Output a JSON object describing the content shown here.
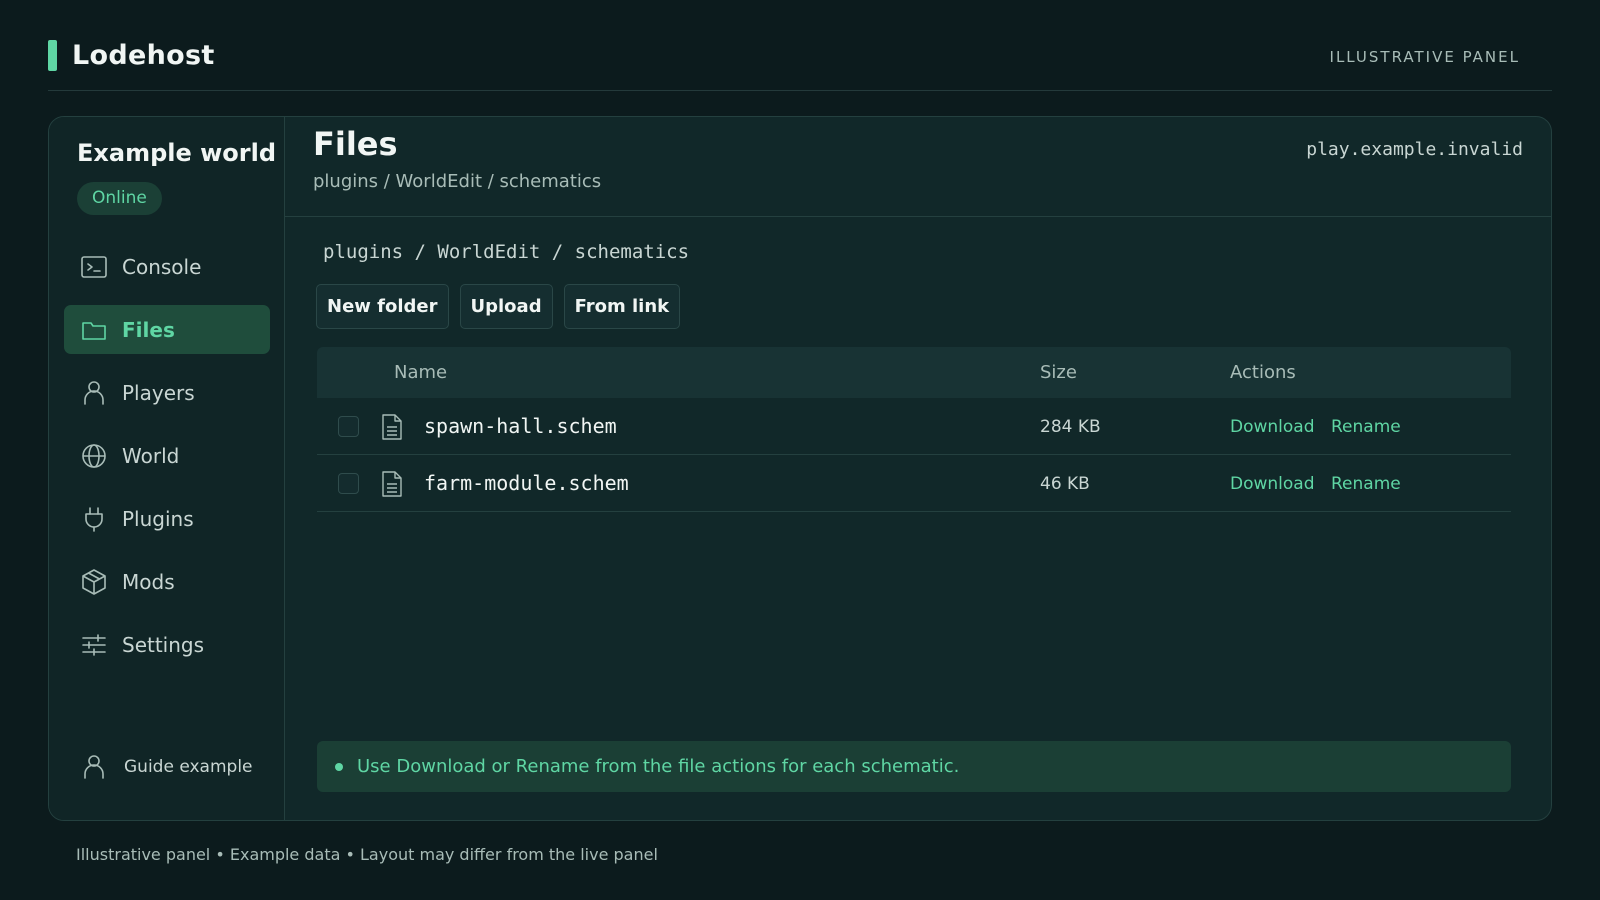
{
  "app": {
    "brand": "Lodehost",
    "top_label": "ILLUSTRATIVE PANEL",
    "accent_color": "#5fd6a4"
  },
  "sidebar": {
    "server_name": "Example world",
    "status": "Online",
    "items": [
      {
        "label": "Console",
        "icon": "terminal-icon",
        "active": false
      },
      {
        "label": "Files",
        "icon": "folder-icon",
        "active": true
      },
      {
        "label": "Players",
        "icon": "user-icon",
        "active": false
      },
      {
        "label": "World",
        "icon": "globe-icon",
        "active": false
      },
      {
        "label": "Plugins",
        "icon": "plug-icon",
        "active": false
      },
      {
        "label": "Mods",
        "icon": "cube-icon",
        "active": false
      },
      {
        "label": "Settings",
        "icon": "sliders-icon",
        "active": false
      }
    ],
    "user_label": "Guide example"
  },
  "header": {
    "title": "Files",
    "breadcrumb": "plugins / WorldEdit / schematics",
    "host": "play.example.invalid"
  },
  "files": {
    "path": "plugins / WorldEdit / schematics",
    "buttons": {
      "new_folder": "New folder",
      "upload": "Upload",
      "from_link": "From link"
    },
    "columns": {
      "name": "Name",
      "size": "Size",
      "actions": "Actions"
    },
    "rows": [
      {
        "name": "spawn-hall.schem",
        "size": "284 KB",
        "download": "Download",
        "rename": "Rename"
      },
      {
        "name": "farm-module.schem",
        "size": "46 KB",
        "download": "Download",
        "rename": "Rename"
      }
    ],
    "notice": "Use Download or Rename from the file actions for each schematic."
  },
  "footer": "Illustrative panel • Example data • Layout may differ from the live panel"
}
